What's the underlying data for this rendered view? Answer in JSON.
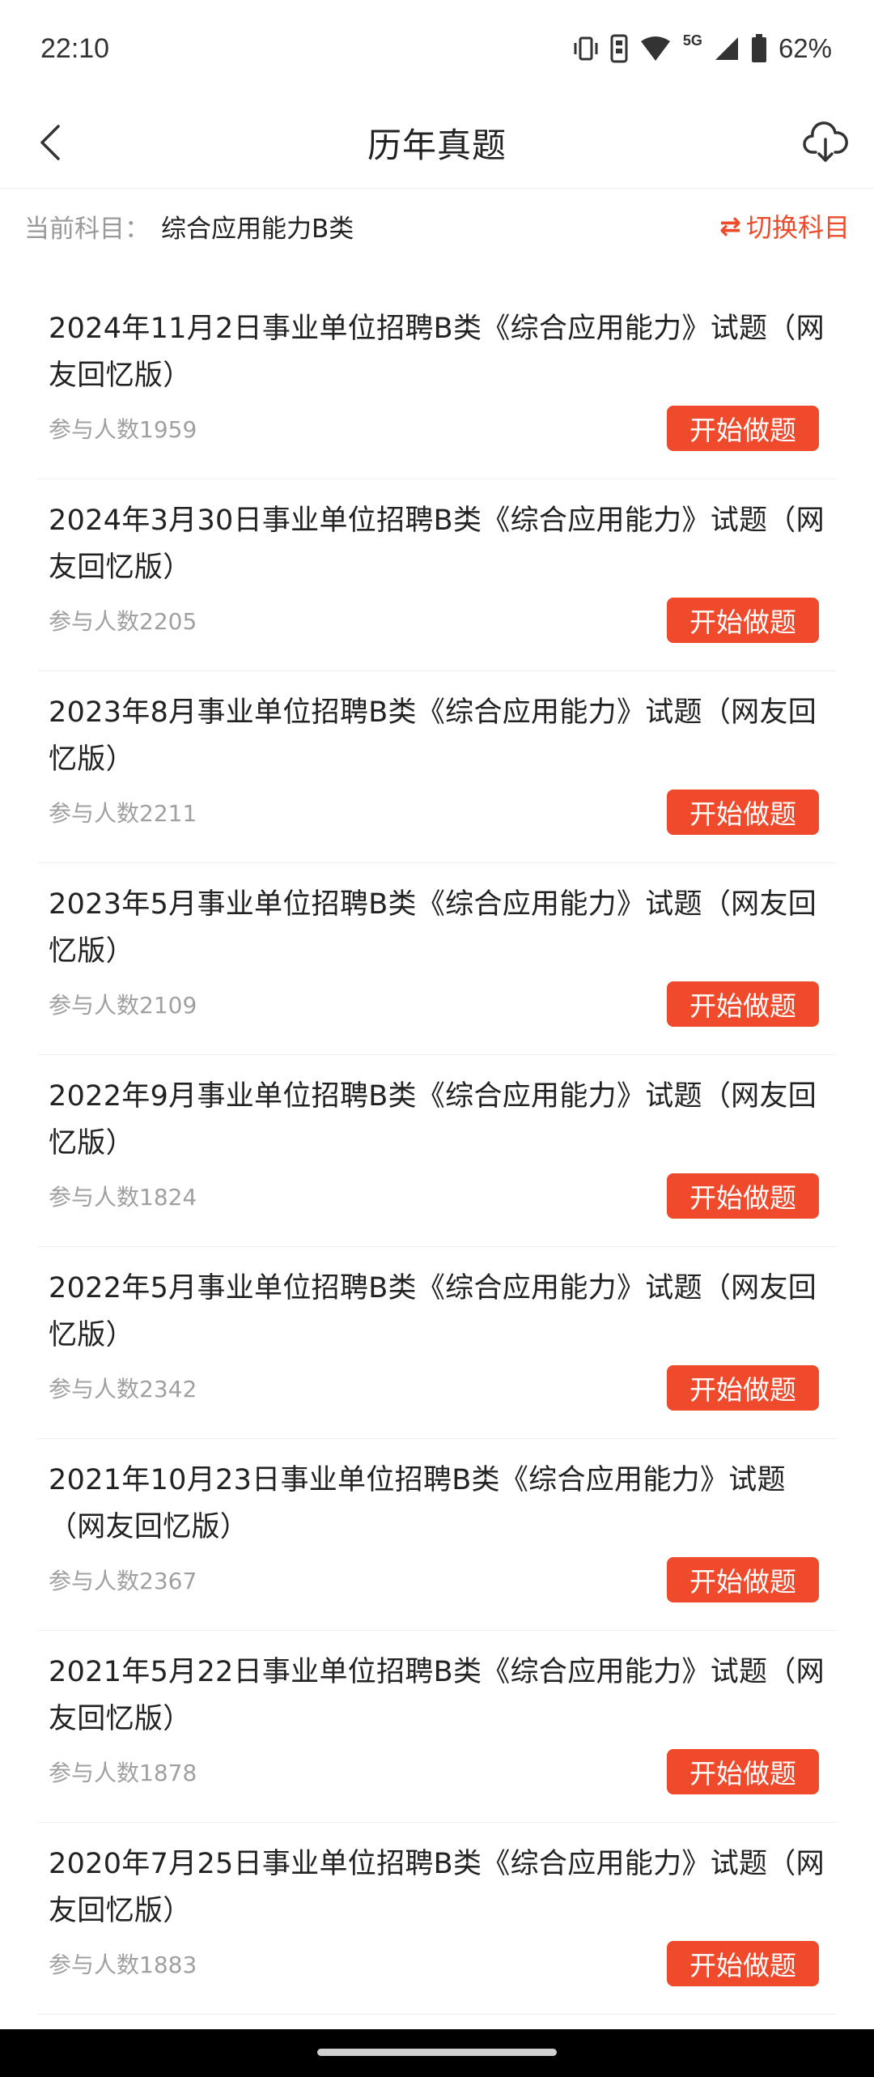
{
  "status_bar": {
    "time": "22:10",
    "network": "5G",
    "battery": "62%",
    "icons": [
      "vibrate-icon",
      "sim-icon",
      "wifi-icon",
      "signal-icon",
      "battery-icon"
    ]
  },
  "nav": {
    "title": "历年真题",
    "back_icon": "chevron-left-icon",
    "download_icon": "cloud-download-icon"
  },
  "subject": {
    "prefix": "当前科目：",
    "value": "综合应用能力B类",
    "switch_icon": "swap-icon",
    "switch_symbol": "⇄",
    "switch_label": "切换科目"
  },
  "colors": {
    "accent": "#f04a2c",
    "muted_text": "#a0a0a0",
    "divider": "#efefef"
  },
  "exams": [
    {
      "title": "2024年11月2日事业单位招聘B类《综合应用能力》试题（网友回忆版）",
      "count": "参与人数1959",
      "button": "开始做题"
    },
    {
      "title": "2024年3月30日事业单位招聘B类《综合应用能力》试题（网友回忆版）",
      "count": "参与人数2205",
      "button": "开始做题"
    },
    {
      "title": "2023年8月事业单位招聘B类《综合应用能力》试题（网友回忆版）",
      "count": "参与人数2211",
      "button": "开始做题"
    },
    {
      "title": "2023年5月事业单位招聘B类《综合应用能力》试题（网友回忆版）",
      "count": "参与人数2109",
      "button": "开始做题"
    },
    {
      "title": "2022年9月事业单位招聘B类《综合应用能力》试题（网友回忆版）",
      "count": "参与人数1824",
      "button": "开始做题"
    },
    {
      "title": "2022年5月事业单位招聘B类《综合应用能力》试题（网友回忆版）",
      "count": "参与人数2342",
      "button": "开始做题"
    },
    {
      "title": "2021年10月23日事业单位招聘B类《综合应用能力》试题（网友回忆版）",
      "count": "参与人数2367",
      "button": "开始做题"
    },
    {
      "title": "2021年5月22日事业单位招聘B类《综合应用能力》试题（网友回忆版）",
      "count": "参与人数1878",
      "button": "开始做题"
    },
    {
      "title": "2020年7月25日事业单位招聘B类《综合应用能力》试题（网友回忆版）",
      "count": "参与人数1883",
      "button": "开始做题"
    }
  ]
}
